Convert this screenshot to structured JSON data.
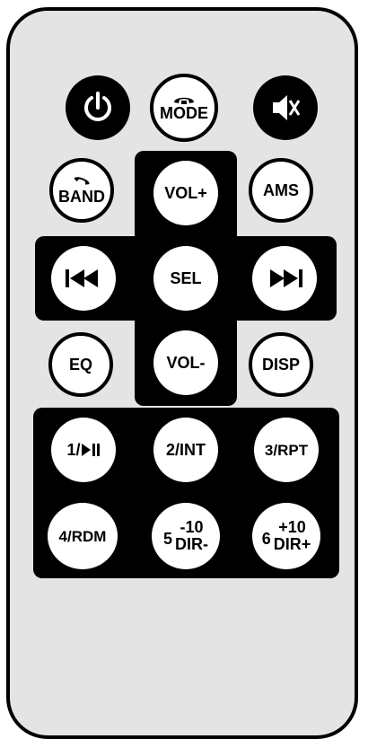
{
  "buttons": {
    "power": {
      "icon": "power-icon"
    },
    "mode": {
      "label": "MODE",
      "icon": "phone-hangup-icon"
    },
    "mute": {
      "icon": "speaker-mute-icon"
    },
    "band": {
      "label": "BAND",
      "icon": "phone-answer-icon"
    },
    "vol_up": {
      "label": "VOL+"
    },
    "ams": {
      "label": "AMS"
    },
    "prev": {
      "icon": "skip-previous-icon"
    },
    "sel": {
      "label": "SEL"
    },
    "next": {
      "icon": "skip-next-icon"
    },
    "eq": {
      "label": "EQ"
    },
    "vol_down": {
      "label": "VOL-"
    },
    "disp": {
      "label": "DISP"
    },
    "b1": {
      "label": "1/",
      "icon": "play-pause-icon"
    },
    "b2": {
      "label": "2/INT"
    },
    "b3": {
      "label": "3/RPT"
    },
    "b4": {
      "label": "4/RDM"
    },
    "b5": {
      "num": "5",
      "top": "-10",
      "bottom": "DIR-"
    },
    "b6": {
      "num": "6",
      "top": "+10",
      "bottom": "DIR+"
    }
  },
  "colors": {
    "body": "#e4e4e4",
    "outline": "#000000",
    "button": "#ffffff"
  }
}
